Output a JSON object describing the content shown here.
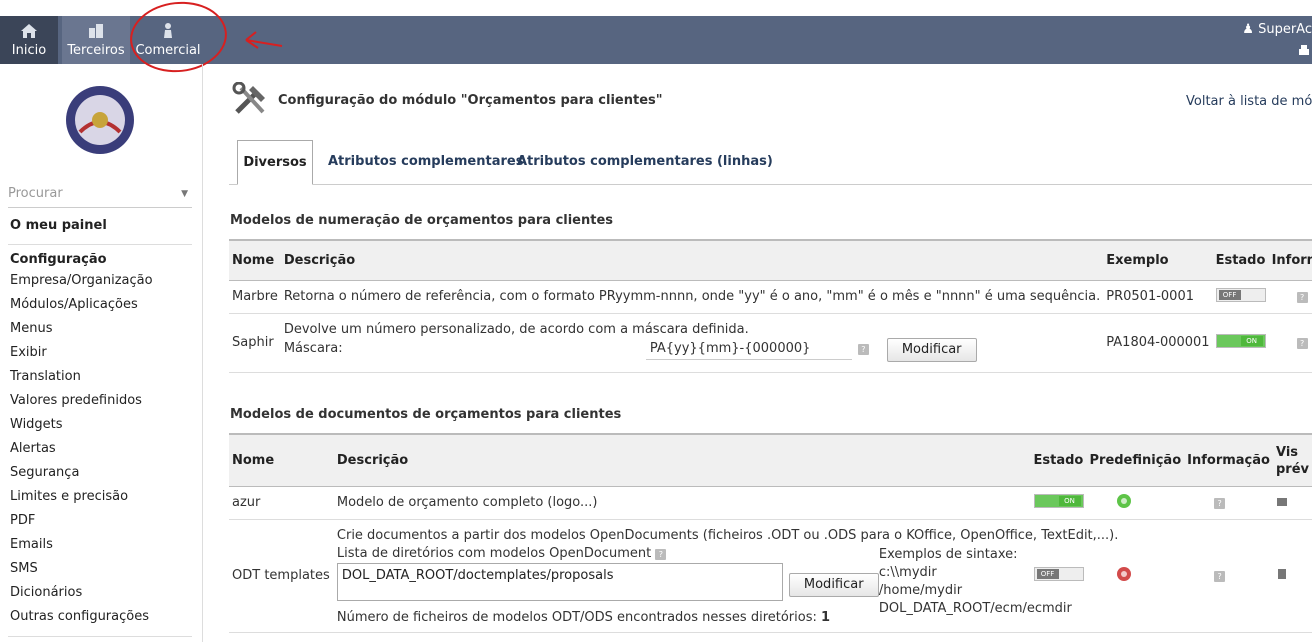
{
  "topnav": {
    "items": [
      {
        "label": "Inicio",
        "icon": "home-icon"
      },
      {
        "label": "Terceiros",
        "icon": "company-icon"
      },
      {
        "label": "Comercial",
        "icon": "commercial-icon"
      }
    ],
    "user": "SuperAc"
  },
  "sidebar": {
    "search_placeholder": "Procurar",
    "my_panel": "O meu painel",
    "config_head": "Configuração",
    "items": [
      "Empresa/Organização",
      "Módulos/Aplicações",
      "Menus",
      "Exibir",
      "Translation",
      "Valores predefinidos",
      "Widgets",
      "Alertas",
      "Segurança",
      "Limites e precisão",
      "PDF",
      "Emails",
      "SMS",
      "Dicionários",
      "Outras configurações"
    ]
  },
  "page": {
    "title": "Configuração do módulo \"Orçamentos para clientes\"",
    "back_link": "Voltar à lista de módu",
    "tabs": [
      "Diversos",
      "Atributos complementares",
      "Atributos complementares (linhas)"
    ]
  },
  "numbering": {
    "section_title": "Modelos de numeração de orçamentos para clientes",
    "headers": [
      "Nome",
      "Descrição",
      "Exemplo",
      "Estado",
      "Informaç"
    ],
    "rows": [
      {
        "name": "Marbre",
        "desc": "Retorna o número de referência, com o formato PRyymm-nnnn, onde \"yy\" é o ano, \"mm\" é o mês e \"nnnn\" é uma sequência.",
        "example": "PR0501-0001",
        "state": "OFF"
      },
      {
        "name": "Saphir",
        "desc": "Devolve um número personalizado, de acordo com a máscara definida.",
        "mask_label": "Máscara:",
        "mask_value": "PA{yy}{mm}-{000000}",
        "modify": "Modificar",
        "example": "PA1804-000001",
        "state": "ON"
      }
    ]
  },
  "documents": {
    "section_title": "Modelos de documentos de orçamentos para clientes",
    "headers": [
      "Nome",
      "Descrição",
      "Estado",
      "Predefinição",
      "Informação",
      "Vis",
      "prév"
    ],
    "rows": [
      {
        "name": "azur",
        "desc": "Modelo de orçamento completo (logo...)",
        "state": "ON"
      },
      {
        "name": "ODT templates",
        "desc": "Crie documentos a partir dos modelos OpenDocuments (ficheiros .ODT ou .ODS para o KOffice, OpenOffice, TextEdit,...).",
        "dir_label": "Lista de diretórios com modelos OpenDocument",
        "dir_value": "DOL_DATA_ROOT/doctemplates/proposals",
        "modify": "Modificar",
        "syntax_label": "Exemplos de sintaxe:",
        "syntax_examples": [
          "c:\\\\mydir",
          "/home/mydir",
          "DOL_DATA_ROOT/ecm/ecmdir"
        ],
        "count_label": "Número de ficheiros de modelos ODT/ODS encontrados nesses diretórios:",
        "count": "1",
        "state": "OFF"
      }
    ]
  },
  "colors": {
    "topbar": "#576580",
    "annotation": "#d72020"
  }
}
